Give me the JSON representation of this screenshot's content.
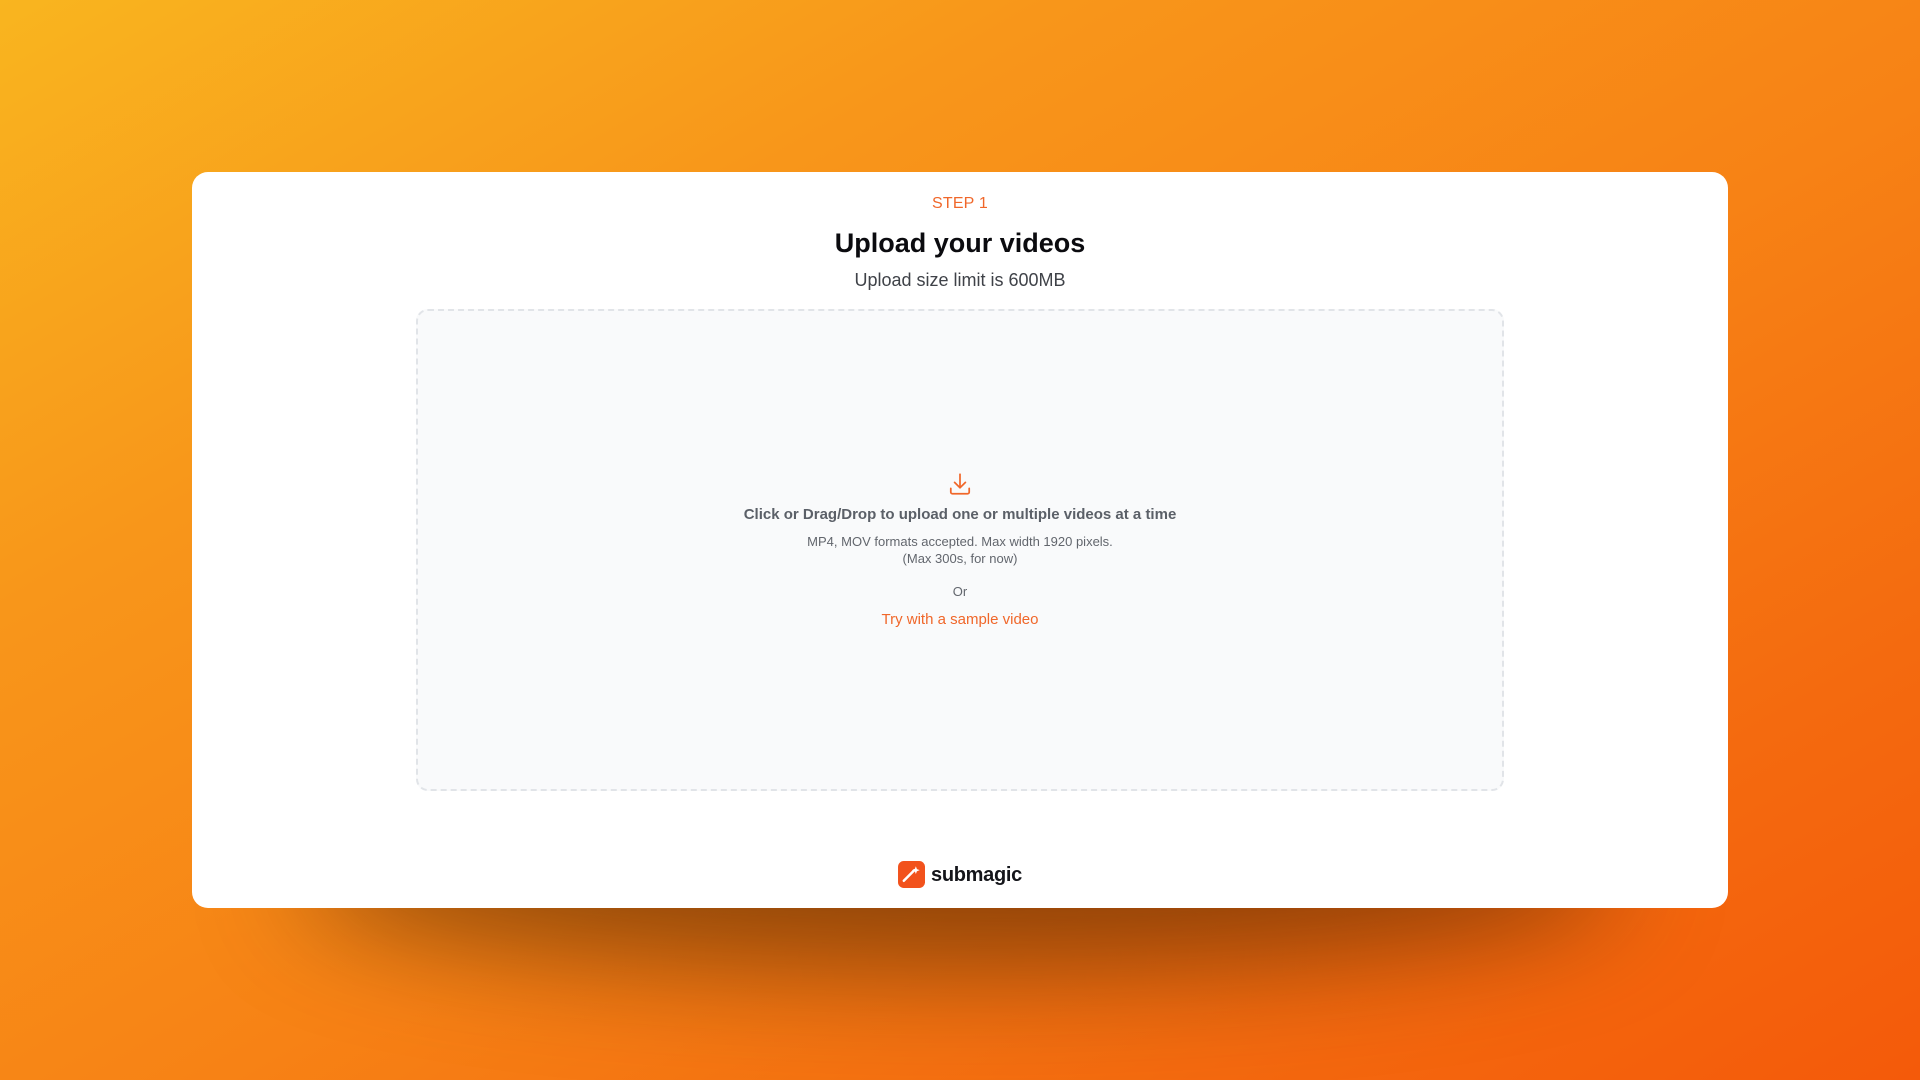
{
  "header": {
    "step_label": "STEP 1",
    "title": "Upload your videos",
    "subtitle": "Upload size limit is 600MB"
  },
  "dropzone": {
    "icon": "download-icon",
    "title": "Click or Drag/Drop to upload one or multiple videos at a time",
    "formats_note": "MP4, MOV formats accepted. Max width 1920 pixels.",
    "duration_note": "(Max 300s, for now)",
    "or_text": "Or",
    "sample_link": "Try with a sample video"
  },
  "brand": {
    "logo_icon": "submagic-logo-icon",
    "name": "submagic"
  },
  "colors": {
    "accent": "#f0672a",
    "background_gradient_start": "#f9b51f",
    "background_gradient_end": "#f45a0a",
    "card_background": "#ffffff",
    "dropzone_background": "#f9fafb"
  }
}
